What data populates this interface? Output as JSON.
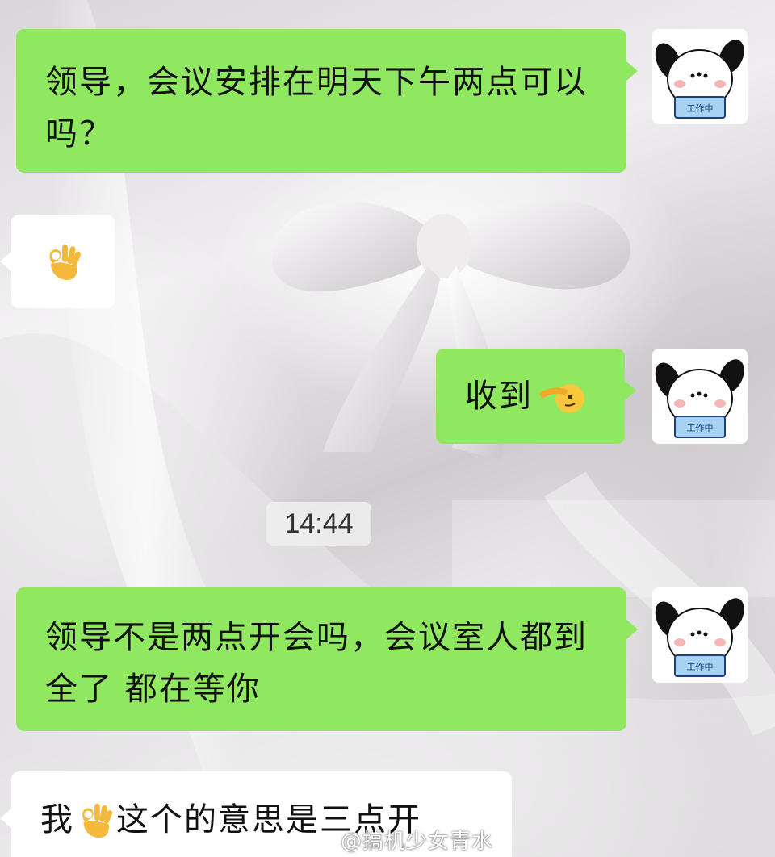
{
  "messages": [
    {
      "side": "right",
      "text": "领导，会议安排在明天下午两点可以吗？"
    },
    {
      "side": "left",
      "emoji": "ok-hand"
    },
    {
      "side": "right",
      "text": "收到",
      "emoji": "saluting-face"
    },
    {
      "side": "right",
      "text": "领导不是两点开会吗，会议室人都到全了 都在等你"
    },
    {
      "side": "left",
      "text_before": "我",
      "emoji": "ok-hand",
      "text_after": "这个的意思是三点开"
    }
  ],
  "timestamp": "14:44",
  "avatar": {
    "caption": "工作中",
    "icon": "pochacco-dog-avatar-icon"
  },
  "watermark": {
    "text": "@搞机少女青水",
    "icon": "weibo-icon"
  },
  "colors": {
    "sent_bubble": "#8fe85f",
    "received_bubble": "#ffffff"
  }
}
